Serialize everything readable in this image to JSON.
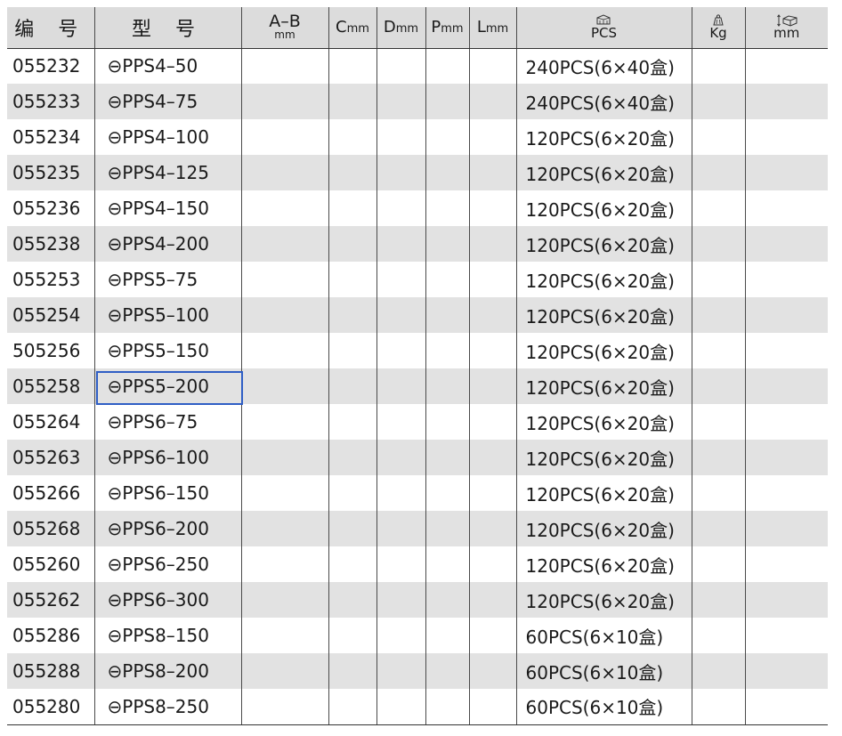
{
  "headers": {
    "code": "编 号",
    "model": "型 号",
    "ab_top": "A–B",
    "ab_unit": "mm",
    "c": "C",
    "d": "D",
    "p": "P",
    "l": "L",
    "unit": "mm",
    "pcs": "PCS",
    "kg": "Kg",
    "size": "mm"
  },
  "header_icons": {
    "pcs": "box-stack-icon",
    "kg": "weight-icon",
    "size": "carton-dimension-icon"
  },
  "rows": [
    {
      "code": "055232",
      "model": "⊖PPS4–50",
      "pack": "240PCS(6×40盒)"
    },
    {
      "code": "055233",
      "model": "⊖PPS4–75",
      "pack": "240PCS(6×40盒)"
    },
    {
      "code": "055234",
      "model": "⊖PPS4–100",
      "pack": "120PCS(6×20盒)"
    },
    {
      "code": "055235",
      "model": "⊖PPS4–125",
      "pack": "120PCS(6×20盒)"
    },
    {
      "code": "055236",
      "model": "⊖PPS4–150",
      "pack": "120PCS(6×20盒)"
    },
    {
      "code": "055238",
      "model": "⊖PPS4–200",
      "pack": "120PCS(6×20盒)"
    },
    {
      "code": "055253",
      "model": "⊖PPS5–75",
      "pack": "120PCS(6×20盒)"
    },
    {
      "code": "055254",
      "model": "⊖PPS5–100",
      "pack": "120PCS(6×20盒)"
    },
    {
      "code": "505256",
      "model": "⊖PPS5–150",
      "pack": "120PCS(6×20盒)"
    },
    {
      "code": "055258",
      "model": "⊖PPS5–200",
      "pack": "120PCS(6×20盒)"
    },
    {
      "code": "055264",
      "model": "⊖PPS6–75",
      "pack": "120PCS(6×20盒)"
    },
    {
      "code": "055263",
      "model": "⊖PPS6–100",
      "pack": "120PCS(6×20盒)"
    },
    {
      "code": "055266",
      "model": "⊖PPS6–150",
      "pack": "120PCS(6×20盒)"
    },
    {
      "code": "055268",
      "model": "⊖PPS6–200",
      "pack": "120PCS(6×20盒)"
    },
    {
      "code": "055260",
      "model": "⊖PPS6–250",
      "pack": "120PCS(6×20盒)"
    },
    {
      "code": "055262",
      "model": "⊖PPS6–300",
      "pack": "120PCS(6×20盒)"
    },
    {
      "code": "055286",
      "model": "⊖PPS8–150",
      "pack": "60PCS(6×10盒)"
    },
    {
      "code": "055288",
      "model": "⊖PPS8–200",
      "pack": "60PCS(6×10盒)"
    },
    {
      "code": "055280",
      "model": "⊖PPS8–250",
      "pack": "60PCS(6×10盒)"
    }
  ],
  "selected_model_row": 10,
  "colors": {
    "header_bg": "#dcdcdc",
    "alt_row_bg": "#e2e2e2",
    "selection_border": "#2f5ec5"
  }
}
